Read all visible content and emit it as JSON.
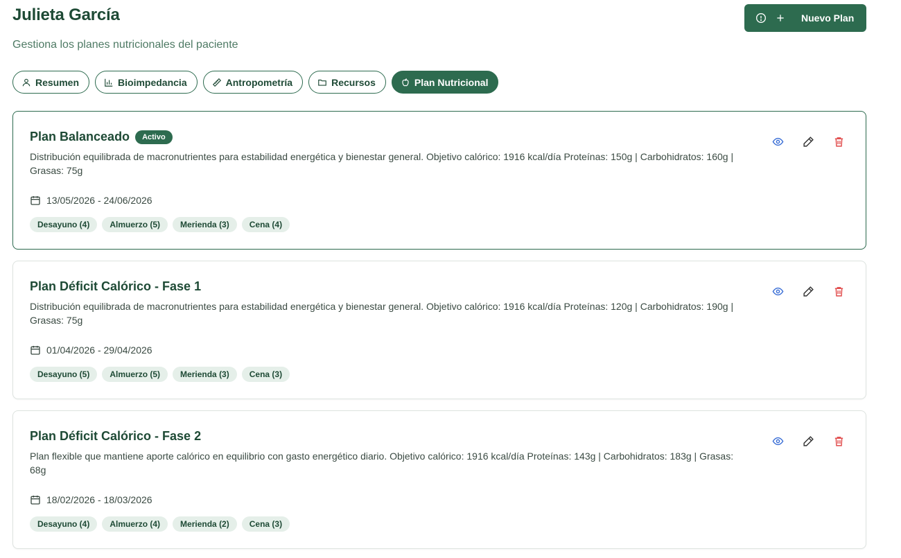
{
  "header": {
    "title": "Julieta García",
    "subtitle": "Gestiona los planes nutricionales del paciente",
    "new_plan_label": "Nuevo Plan"
  },
  "tabs": [
    {
      "label": "Resumen",
      "icon": "user-icon",
      "active": false
    },
    {
      "label": "Bioimpedancia",
      "icon": "bar-chart-icon",
      "active": false
    },
    {
      "label": "Antropometría",
      "icon": "ruler-icon",
      "active": false
    },
    {
      "label": "Recursos",
      "icon": "folder-icon",
      "active": false
    },
    {
      "label": "Plan Nutricional",
      "icon": "apple-icon",
      "active": true
    }
  ],
  "plans": [
    {
      "title": "Plan Balanceado",
      "badge": "Activo",
      "description": "Distribución equilibrada de macronutrientes para estabilidad energética y bienestar general. Objetivo calórico: 1916 kcal/día Proteínas: 150g | Carbohidratos: 160g | Grasas: 75g",
      "dates": "13/05/2026 - 24/06/2026",
      "meals": [
        "Desayuno (4)",
        "Almuerzo (5)",
        "Merienda (3)",
        "Cena (4)"
      ]
    },
    {
      "title": "Plan Déficit Calórico - Fase 1",
      "badge": "",
      "description": "Distribución equilibrada de macronutrientes para estabilidad energética y bienestar general. Objetivo calórico: 1916 kcal/día Proteínas: 120g | Carbohidratos: 190g | Grasas: 75g",
      "dates": "01/04/2026 - 29/04/2026",
      "meals": [
        "Desayuno (5)",
        "Almuerzo (5)",
        "Merienda (3)",
        "Cena (3)"
      ]
    },
    {
      "title": "Plan Déficit Calórico - Fase 2",
      "badge": "",
      "description": "Plan flexible que mantiene aporte calórico en equilibrio con gasto energético diario. Objetivo calórico: 1916 kcal/día Proteínas: 143g | Carbohidratos: 183g | Grasas: 68g",
      "dates": "18/02/2026 - 18/03/2026",
      "meals": [
        "Desayuno (4)",
        "Almuerzo (4)",
        "Merienda (2)",
        "Cena (3)"
      ]
    }
  ],
  "colors": {
    "primary": "#2d6b4f",
    "view_icon": "#3b6fd6",
    "delete_icon": "#e04848",
    "chip_bg": "#e5efe9"
  }
}
